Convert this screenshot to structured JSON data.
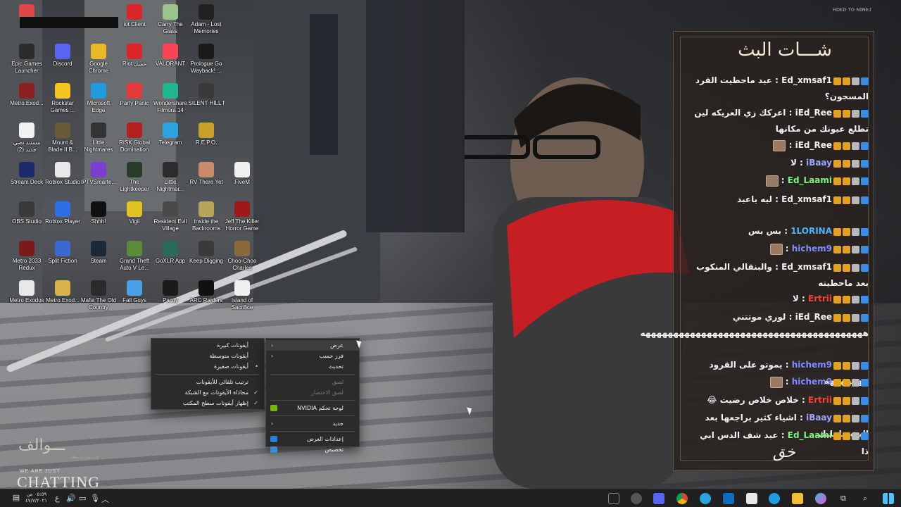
{
  "desktop": {
    "icons": [
      {
        "label": "",
        "color": "#e04646"
      },
      {
        "label": "iot Client",
        "color": "#d8262b"
      },
      {
        "label": "Carry The Glass",
        "color": "#9ac48a"
      },
      {
        "label": "Adam - Lost Memories",
        "color": "#222222"
      },
      {
        "label": "Epic Games Launcher",
        "color": "#2b2b2b"
      },
      {
        "label": "Discord",
        "color": "#5865f2"
      },
      {
        "label": "Google Chrome",
        "color": "#e9b824"
      },
      {
        "label": "Riot عميل",
        "color": "#d8262b"
      },
      {
        "label": "VALORANT",
        "color": "#fa4454"
      },
      {
        "label": "Prologue Go Wayback! ...",
        "color": "#1a1a1a"
      },
      {
        "label": "Metro.Exod...",
        "color": "#8b2020"
      },
      {
        "label": "Rockstar Games ...",
        "color": "#f4c520"
      },
      {
        "label": "Microsoft Edge",
        "color": "#1f9be0"
      },
      {
        "label": "Party Panic",
        "color": "#e33b3b"
      },
      {
        "label": "Wondershare Filmora 14",
        "color": "#1fb58f"
      },
      {
        "label": "SILENT HILL f",
        "color": "#3a3a3a"
      },
      {
        "label": "مستند نصي جديد (2)",
        "color": "#f2f2f2"
      },
      {
        "label": "Mount & Blade II B...",
        "color": "#6a5a3a"
      },
      {
        "label": "Little Nightmares",
        "color": "#333333"
      },
      {
        "label": "RISK Global Domination",
        "color": "#b32020"
      },
      {
        "label": "Telegram",
        "color": "#2aa3df"
      },
      {
        "label": "R.E.P.O.",
        "color": "#c9a02a"
      },
      {
        "label": "Stream Deck",
        "color": "#1d2a6b"
      },
      {
        "label": "Roblox Studio",
        "color": "#e8e8e8"
      },
      {
        "label": "IPTVSmarte...",
        "color": "#7a3fd1"
      },
      {
        "label": "The Lightkeeper",
        "color": "#2a3a2a"
      },
      {
        "label": "Little Nightmar...",
        "color": "#2c2c2c"
      },
      {
        "label": "RV There Yet",
        "color": "#c98b6b"
      },
      {
        "label": "FiveM",
        "color": "#f0f0f0"
      },
      {
        "label": "OBS Studio",
        "color": "#3a3a3a"
      },
      {
        "label": "Roblox Player",
        "color": "#2f6fe6"
      },
      {
        "label": "Shhh!",
        "color": "#111111"
      },
      {
        "label": "Vigil",
        "color": "#e2c21f"
      },
      {
        "label": "Resident Evil Village",
        "color": "#4a4a4a"
      },
      {
        "label": "Inside the Backrooms",
        "color": "#b8a45a"
      },
      {
        "label": "Jeff The Killer Horror Game",
        "color": "#a01818"
      },
      {
        "label": "Metro 2033 Redux",
        "color": "#7a1a1a"
      },
      {
        "label": "Split Fiction",
        "color": "#3a6ad1"
      },
      {
        "label": "Steam",
        "color": "#1b2838"
      },
      {
        "label": "Grand Theft Auto V Le...",
        "color": "#5a8a3a"
      },
      {
        "label": "GoXLR App",
        "color": "#2a6a5a"
      },
      {
        "label": "Keep Digging",
        "color": "#3a3a3a"
      },
      {
        "label": "Choo-Choo Charles",
        "color": "#8a6a3a"
      },
      {
        "label": "Metro Exodus",
        "color": "#e8e8e8"
      },
      {
        "label": "Metro.Exod...",
        "color": "#d8b24a"
      },
      {
        "label": "Mafia The Old Country",
        "color": "#2a2a2a"
      },
      {
        "label": "Fall Guys",
        "color": "#4aa0e6"
      },
      {
        "label": "Pacify",
        "color": "#1a1a1a"
      },
      {
        "label": "ARC Raiders",
        "color": "#111111"
      },
      {
        "label": "Island of Sacrifice",
        "color": "#f0f0f0"
      }
    ]
  },
  "context_menu": {
    "items": [
      {
        "label": "عرض",
        "submenu": true,
        "active": true
      },
      {
        "label": "فرز حسب",
        "submenu": true
      },
      {
        "label": "تحديث"
      },
      {
        "label": "لصق",
        "disabled": true
      },
      {
        "label": "لصق الاختصار",
        "disabled": true
      },
      {
        "label": "لوحة تحكم NVIDIA",
        "icon_color": "#76b900"
      },
      {
        "label": "جديد",
        "submenu": true
      },
      {
        "label": "إعدادات العرض",
        "icon_color": "#2a7de1"
      },
      {
        "label": "تخصيص",
        "icon_color": "#3a8ad8"
      }
    ],
    "submenu": [
      {
        "label": "أيقونات كبيرة"
      },
      {
        "label": "أيقونات متوسطة"
      },
      {
        "label": "أيقونات صغيرة",
        "mark": "•"
      },
      {
        "label": "ترتيب تلقائي للأيقونات"
      },
      {
        "label": "محاذاة الأيقونات مع الشبكة",
        "mark": "✓"
      },
      {
        "label": "إظهار أيقونات سطح المكتب",
        "mark": "✓"
      }
    ]
  },
  "chat": {
    "title": "شـــات البث",
    "messages": [
      {
        "user": "Ed_xmsaf1",
        "text": "عيد ماحطيت القرد المسجون؟",
        "color": "#f2f2f2"
      },
      {
        "user": "iEd_Ree",
        "text": "اعركك زي العريكه لين تطلع عيونك من مكانها",
        "color": "#f2f2f2"
      },
      {
        "user": "iEd_Ree",
        "text": "",
        "color": "#f2f2f2"
      },
      {
        "user": "iBaay",
        "text": "لا",
        "color": "#9aa6ff"
      },
      {
        "user": "Ed_Laami",
        "text": "",
        "color": "#7ef07e"
      },
      {
        "user": "Ed_xmsaf1",
        "text": "ليه ياعيد",
        "color": "#f2f2f2"
      },
      {
        "user": "1LORINA",
        "text": "بس بس",
        "color": "#4ab4ff"
      },
      {
        "user": "hichem9",
        "text": "",
        "color": "#7f8cff"
      },
      {
        "user": "Ed_xmsaf1",
        "text": "والبنقالي المنكوب بعد ماحطيته",
        "color": "#f2f2f2"
      },
      {
        "user": "Ertrii",
        "text": "لا",
        "color": "#ff3a3a"
      },
      {
        "user": "iEd_Ree",
        "text": "لوري موتتني ههههههههههههههههههههههههههههههههههههههههه",
        "color": "#f2f2f2"
      },
      {
        "user": "hichem9",
        "text": "يموتو على القرود هههههههه",
        "color": "#7f8cff"
      },
      {
        "user": "hichem9",
        "text": "",
        "color": "#7f8cff"
      },
      {
        "user": "Ertrii",
        "text": "خلاص خلاص رضيت 😂",
        "color": "#ff3a3a"
      },
      {
        "user": "iBaay",
        "text": "اشياء كثير براجعها بعد البث ماعليك",
        "color": "#9aa6ff"
      },
      {
        "user": "Ed_Laami",
        "text": "عيد شف الدس ابي ذا",
        "color": "#7ef07e"
      }
    ],
    "logo": "ﺧﻖ"
  },
  "overlay": {
    "watermark": "ʜᴅᴇᴅ ᴛᴏ ɴɪɴᴇᴊ",
    "brand_arabic": "ـــوالف",
    "brand_sub": "جـــــيب ـــ معالـ",
    "brand_small": "WE ARE JUST",
    "brand_big": "CHATTING"
  },
  "taskbar": {
    "time": "٠٥:٥٩ ص",
    "date": "٤٧/٧/٢٠٢١",
    "lang": "ع"
  }
}
